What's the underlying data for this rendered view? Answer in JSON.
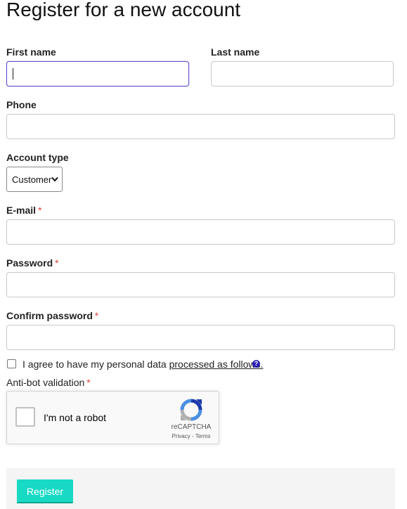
{
  "page": {
    "title": "Register for a new account"
  },
  "form": {
    "first_name": {
      "label": "First name",
      "value": ""
    },
    "last_name": {
      "label": "Last name",
      "value": ""
    },
    "phone": {
      "label": "Phone",
      "value": ""
    },
    "account_type": {
      "label": "Account type",
      "selected": "Customer"
    },
    "email": {
      "label": "E-mail",
      "required_mark": "*",
      "value": ""
    },
    "password": {
      "label": "Password",
      "required_mark": "*",
      "value": ""
    },
    "confirm_password": {
      "label": "Confirm password",
      "required_mark": "*",
      "value": ""
    },
    "agree": {
      "text": "I agree to have my personal data",
      "link": "processed as follows.",
      "help_icon": "question-circle-icon",
      "help_glyph": "?",
      "checked": false
    },
    "antibot": {
      "label": "Anti-bot validation",
      "required_mark": "*"
    }
  },
  "recaptcha": {
    "label": "I'm not a robot",
    "brand": "reCAPTCHA",
    "terms": "Privacy - Terms",
    "checked": false
  },
  "actions": {
    "register_label": "Register"
  },
  "colors": {
    "focus_border": "#5b4fd1",
    "required": "#e0453a",
    "button_bg": "#17d9c4",
    "help_icon": "#2a1fb3"
  }
}
